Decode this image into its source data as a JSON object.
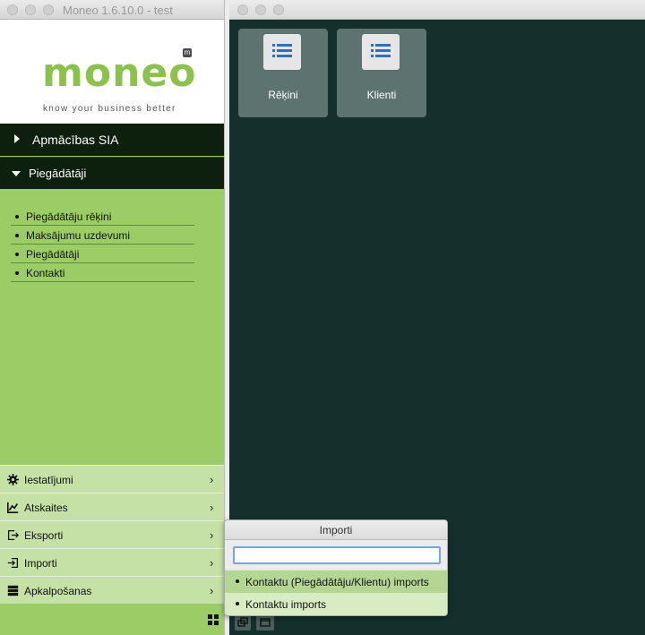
{
  "left_window": {
    "title": "Moneo 1.6.10.0 - test",
    "logo": {
      "brand": "moneo",
      "badge": "m",
      "tagline": "know your business better"
    },
    "company": "Apmācības SIA",
    "section": {
      "label": "Piegādātāji",
      "items": [
        {
          "label": "Piegādātāju rēķini"
        },
        {
          "label": "Maksājumu uzdevumi"
        },
        {
          "label": "Piegādātāji"
        },
        {
          "label": "Kontakti"
        }
      ]
    },
    "bottom_menu": [
      {
        "label": "Iestatījumi",
        "icon": "gear-icon"
      },
      {
        "label": "Atskaites",
        "icon": "chart-icon"
      },
      {
        "label": "Eksporti",
        "icon": "export-icon"
      },
      {
        "label": "Importi",
        "icon": "import-icon"
      },
      {
        "label": "Apkalpošanas",
        "icon": "server-icon"
      }
    ]
  },
  "right_window": {
    "tiles": [
      {
        "label": "Rēķini",
        "icon": "list-icon"
      },
      {
        "label": "Klienti",
        "icon": "list-icon"
      }
    ]
  },
  "popup": {
    "title": "Importi",
    "search_value": "",
    "items": [
      {
        "label": "Kontaktu (Piegādātāju/Klientu) imports"
      },
      {
        "label": "Kontaktu imports"
      }
    ]
  },
  "colors": {
    "brand_green": "#8bc34a",
    "sidebar_green": "#9ccc65",
    "dark_header": "#0d1f0d",
    "workspace": "#15302c"
  }
}
